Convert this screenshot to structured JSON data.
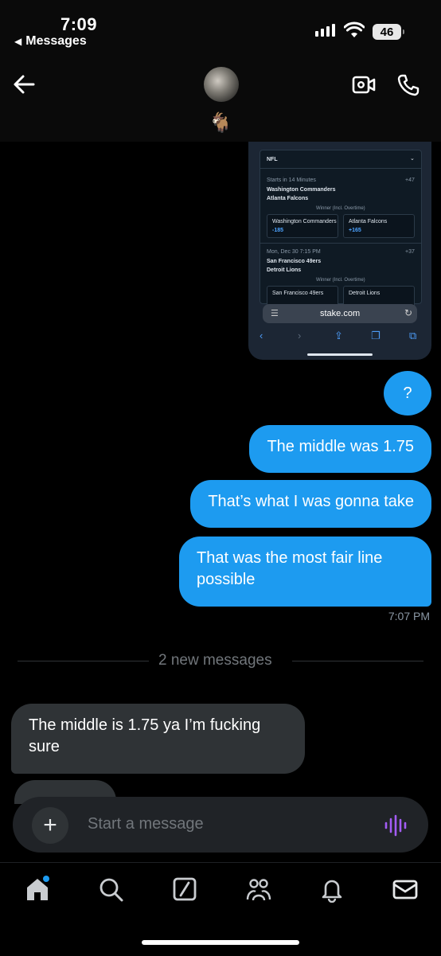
{
  "status_bar": {
    "time": "7:09",
    "back_app": "Messages",
    "battery": "46"
  },
  "header": {
    "avatar_emoji": "🐐"
  },
  "shared_screenshot": {
    "league": "NFL",
    "game1": {
      "starts": "Starts in 14 Minutes",
      "count": "+47",
      "team1": "Washington Commanders",
      "team2": "Atlanta Falcons",
      "market": "Winner (Incl. Overtime)",
      "odds1": "-185",
      "odds2": "+165"
    },
    "game2": {
      "starts": "Mon, Dec 30 7:15 PM",
      "count": "+37",
      "team1": "San Francisco 49ers",
      "team2": "Detroit Lions",
      "market": "Winner (Incl. Overtime)"
    },
    "url": "stake.com"
  },
  "messages": {
    "sent": [
      {
        "text": "?"
      },
      {
        "text": "The middle was 1.75"
      },
      {
        "text": "That’s what I was gonna take"
      },
      {
        "text": "That was the most fair line possible"
      }
    ],
    "sent_time": "7:07 PM",
    "new_messages_label": "2 new messages",
    "received": [
      {
        "text": "The middle is 1.75 ya I’m fucking sure"
      }
    ]
  },
  "composer": {
    "placeholder": "Start a message"
  },
  "colors": {
    "accent": "#1d9bf0",
    "received_bubble": "#2f3336",
    "voice_icon": "#a35cf5"
  }
}
